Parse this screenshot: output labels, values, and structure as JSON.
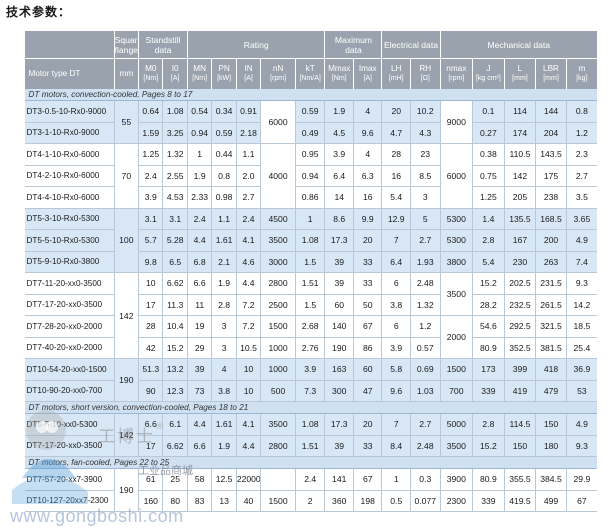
{
  "page_title": "技术参数：",
  "header": {
    "groups": [
      "Square flange",
      "Standstill data",
      "Rating",
      "Maximum data",
      "Electrical data",
      "Mechanical data"
    ],
    "motor_type": "Motor type DT",
    "cols": [
      {
        "sym": "mm",
        "unit": ""
      },
      {
        "sym": "M0",
        "unit": "[Nm]"
      },
      {
        "sym": "I0",
        "unit": "[A]"
      },
      {
        "sym": "MN",
        "unit": "[Nm]"
      },
      {
        "sym": "PN",
        "unit": "[kW]"
      },
      {
        "sym": "IN",
        "unit": "[A]"
      },
      {
        "sym": "nN",
        "unit": "[rpm]"
      },
      {
        "sym": "kT",
        "unit": "[Nm/A]"
      },
      {
        "sym": "Mmax",
        "unit": "[Nm]"
      },
      {
        "sym": "Imax",
        "unit": "[A]"
      },
      {
        "sym": "LH",
        "unit": "[mH]"
      },
      {
        "sym": "RH",
        "unit": "[Ω]"
      },
      {
        "sym": "nmax",
        "unit": "[rpm]"
      },
      {
        "sym": "J",
        "unit": "[kg cm²]"
      },
      {
        "sym": "L",
        "unit": "[mm]"
      },
      {
        "sym": "LBR",
        "unit": "[mm]"
      },
      {
        "sym": "m",
        "unit": "[kg]"
      }
    ]
  },
  "sections": [
    {
      "title": "DT motors, convection-cooled,",
      "pages": "Pages 8 to 17"
    },
    {
      "title": "DT motors, short version, convection-cooled,",
      "pages": "Pages 18 to 21"
    },
    {
      "title": "DT motors, fan-cooled,",
      "pages": "Pages 22 to 25"
    }
  ],
  "groups": {
    "sq": [
      "55",
      "70",
      "100",
      "142",
      "190",
      "142",
      "190"
    ],
    "nN": [
      "6000",
      "4000"
    ],
    "nmax": [
      "9000",
      "6000",
      "3500",
      "2000"
    ]
  },
  "rows": [
    {
      "name": "DT3-0.5-10-Rx0-9000",
      "M0": "0.64",
      "I0": "1.08",
      "MN": "0.54",
      "PN": "0.34",
      "IN": "0.91",
      "kT": "0.59",
      "Mmax": "1.9",
      "Imax": "4",
      "LH": "20",
      "RH": "10.2",
      "J": "0.1",
      "L": "114",
      "LBR": "144",
      "m": "0.8"
    },
    {
      "name": "DT3-1-10-Rx0-9000",
      "M0": "1.59",
      "I0": "3.25",
      "MN": "0.94",
      "PN": "0.59",
      "IN": "2.18",
      "kT": "0.49",
      "Mmax": "4.5",
      "Imax": "9.6",
      "LH": "4.7",
      "RH": "4.3",
      "J": "0.27",
      "L": "174",
      "LBR": "204",
      "m": "1.2"
    },
    {
      "name": "DT4-1-10-Rx0-6000",
      "M0": "1.25",
      "I0": "1.32",
      "MN": "1",
      "PN": "0.44",
      "IN": "1.1",
      "kT": "0.95",
      "Mmax": "3.9",
      "Imax": "4",
      "LH": "28",
      "RH": "23",
      "J": "0.38",
      "L": "110.5",
      "LBR": "143.5",
      "m": "2.3"
    },
    {
      "name": "DT4-2-10-Rx0-6000",
      "M0": "2.4",
      "I0": "2.55",
      "MN": "1.9",
      "PN": "0.8",
      "IN": "2.0",
      "kT": "0.94",
      "Mmax": "6.4",
      "Imax": "6.3",
      "LH": "16",
      "RH": "8.5",
      "J": "0.75",
      "L": "142",
      "LBR": "175",
      "m": "2.7"
    },
    {
      "name": "DT4-4-10-Rx0-6000",
      "M0": "3.9",
      "I0": "4.53",
      "MN": "2.33",
      "PN": "0.98",
      "IN": "2.7",
      "kT": "0.86",
      "Mmax": "14",
      "Imax": "16",
      "LH": "5.4",
      "RH": "3",
      "J": "1.25",
      "L": "205",
      "LBR": "238",
      "m": "3.5"
    },
    {
      "name": "DT5-3-10-Rx0-5300",
      "M0": "3.1",
      "I0": "3.1",
      "MN": "2.4",
      "PN": "1.1",
      "IN": "2.4",
      "nN": "4500",
      "kT": "1",
      "Mmax": "8.6",
      "Imax": "9.9",
      "LH": "12.9",
      "RH": "5",
      "nmax": "5300",
      "J": "1.4",
      "L": "135.5",
      "LBR": "168.5",
      "m": "3.65"
    },
    {
      "name": "DT5-5-10-Rx0-5300",
      "M0": "5.7",
      "I0": "5.28",
      "MN": "4.4",
      "PN": "1.61",
      "IN": "4.1",
      "nN": "3500",
      "kT": "1.08",
      "Mmax": "17.3",
      "Imax": "20",
      "LH": "7",
      "RH": "2.7",
      "nmax": "5300",
      "J": "2.8",
      "L": "167",
      "LBR": "200",
      "m": "4.9"
    },
    {
      "name": "DT5-9-10-Rx0-3800",
      "M0": "9.8",
      "I0": "6.5",
      "MN": "6.8",
      "PN": "2.1",
      "IN": "4.6",
      "nN": "3000",
      "kT": "1.5",
      "Mmax": "39",
      "Imax": "33",
      "LH": "6.4",
      "RH": "1.93",
      "nmax": "3800",
      "J": "5.4",
      "L": "230",
      "LBR": "263",
      "m": "7.4"
    },
    {
      "name": "DT7-11-20-xx0-3500",
      "M0": "10",
      "I0": "6.62",
      "MN": "6.6",
      "PN": "1.9",
      "IN": "4.4",
      "nN": "2800",
      "kT": "1.51",
      "Mmax": "39",
      "Imax": "33",
      "LH": "6",
      "RH": "2.48",
      "J": "15.2",
      "L": "202.5",
      "LBR": "231.5",
      "m": "9.3"
    },
    {
      "name": "DT7-17-20-xx0-3500",
      "M0": "17",
      "I0": "11.3",
      "MN": "11",
      "PN": "2.8",
      "IN": "7.2",
      "nN": "2500",
      "kT": "1.5",
      "Mmax": "60",
      "Imax": "50",
      "LH": "3.8",
      "RH": "1.32",
      "J": "28.2",
      "L": "232.5",
      "LBR": "261.5",
      "m": "14.2"
    },
    {
      "name": "DT7-28-20-xx0-2000",
      "M0": "28",
      "I0": "10.4",
      "MN": "19",
      "PN": "3",
      "IN": "7.2",
      "nN": "1500",
      "kT": "2.68",
      "Mmax": "140",
      "Imax": "67",
      "LH": "6",
      "RH": "1.2",
      "J": "54.6",
      "L": "292.5",
      "LBR": "321.5",
      "m": "18.5"
    },
    {
      "name": "DT7-40-20-xx0-2000",
      "M0": "42",
      "I0": "15.2",
      "MN": "29",
      "PN": "3",
      "IN": "10.5",
      "nN": "1000",
      "kT": "2.76",
      "Mmax": "190",
      "Imax": "86",
      "LH": "3.9",
      "RH": "0.57",
      "J": "80.9",
      "L": "352.5",
      "LBR": "381.5",
      "m": "25.4"
    },
    {
      "name": "DT10-54-20-xx0-1500",
      "M0": "51.3",
      "I0": "13.2",
      "MN": "39",
      "PN": "4",
      "IN": "10",
      "nN": "1000",
      "kT": "3.9",
      "Mmax": "163",
      "Imax": "60",
      "LH": "5.8",
      "RH": "0.69",
      "nmax": "1500",
      "J": "173",
      "L": "399",
      "LBR": "418",
      "m": "36.9"
    },
    {
      "name": "DT10-90-20-xx0-700",
      "M0": "90",
      "I0": "12.3",
      "MN": "73",
      "PN": "3.8",
      "IN": "10",
      "nN": "500",
      "kT": "7.3",
      "Mmax": "300",
      "Imax": "47",
      "LH": "9.6",
      "RH": "1.03",
      "nmax": "700",
      "J": "339",
      "L": "419",
      "LBR": "479",
      "m": "53"
    },
    {
      "name": "DT5-5-10-xx0-5300",
      "M0": "6.6",
      "I0": "6.1",
      "MN": "4.4",
      "PN": "1.61",
      "IN": "4.1",
      "nN": "3500",
      "kT": "1.08",
      "Mmax": "17.3",
      "Imax": "20",
      "LH": "7",
      "RH": "2.7",
      "nmax": "5000",
      "J": "2.8",
      "L": "114.5",
      "LBR": "150",
      "m": "4.9"
    },
    {
      "name": "DT7-17-20-xx0-3500",
      "M0": "17",
      "I0": "6.62",
      "MN": "6.6",
      "PN": "1.9",
      "IN": "4.4",
      "nN": "2800",
      "kT": "1.51",
      "Mmax": "39",
      "Imax": "33",
      "LH": "8.4",
      "RH": "2.48",
      "nmax": "3500",
      "J": "15.2",
      "L": "150",
      "LBR": "180",
      "m": "9.3"
    },
    {
      "name": "DT7-57-20-xx7-3900",
      "M0": "61",
      "I0": "25",
      "MN": "58",
      "PN": "12.5",
      "IN": "22000",
      "kT": "2.4",
      "Mmax": "141",
      "Imax": "67",
      "LH": "1",
      "RH": "0.3",
      "nmax": "3900",
      "J": "80.9",
      "L": "355.5",
      "LBR": "384.5",
      "m": "29.9"
    },
    {
      "name": "DT10-127-20xx7-2300",
      "M0": "160",
      "I0": "80",
      "MN": "83",
      "PN": "13",
      "IN": "40",
      "nN": "1500",
      "kT": "2",
      "Mmax": "360",
      "Imax": "198",
      "LH": "0.5",
      "RH": "0.077",
      "nmax": "2300",
      "J": "339",
      "L": "419.5",
      "LBR": "499",
      "m": "67"
    }
  ],
  "watermark": {
    "brand": "工博士",
    "tagline": "工业品商城",
    "url": "www.gongboshi.com",
    "registered": "®"
  }
}
